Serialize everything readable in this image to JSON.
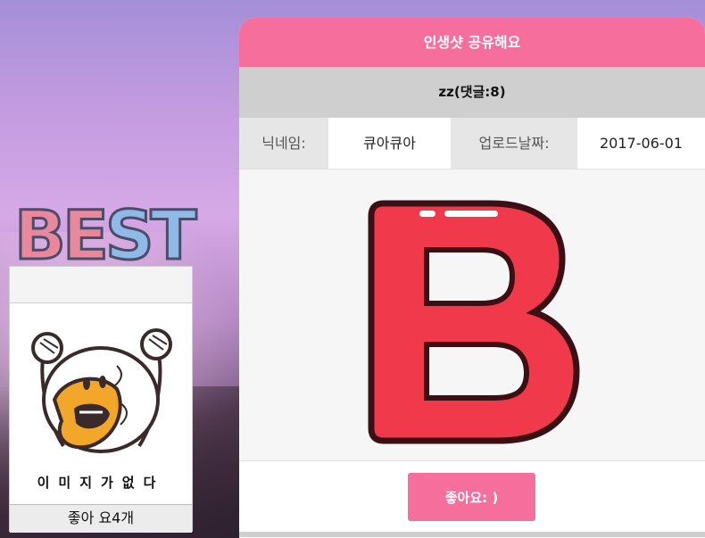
{
  "best": {
    "logo_text": "BEST",
    "no_image_text": "이미지가없다",
    "like_count": "좋아 요4개"
  },
  "panel": {
    "header_title": "인생샷 공유해요",
    "post_title": "zz(댓글:8)",
    "meta": {
      "nickname_label": "닉네임:",
      "nickname_value": "큐아큐아",
      "upload_date_label": "업로드날짜:",
      "upload_date_value": "2017-06-01"
    },
    "like_button_label": "좋아요: )"
  },
  "colors": {
    "accent_pink": "#f66e9b",
    "logo_pink": "#e9879c",
    "logo_blue": "#8fb9e6",
    "b_red": "#f03a4b"
  },
  "icons": [
    "screaming-duck-sticker-icon",
    "letter-b-sticker-icon"
  ]
}
